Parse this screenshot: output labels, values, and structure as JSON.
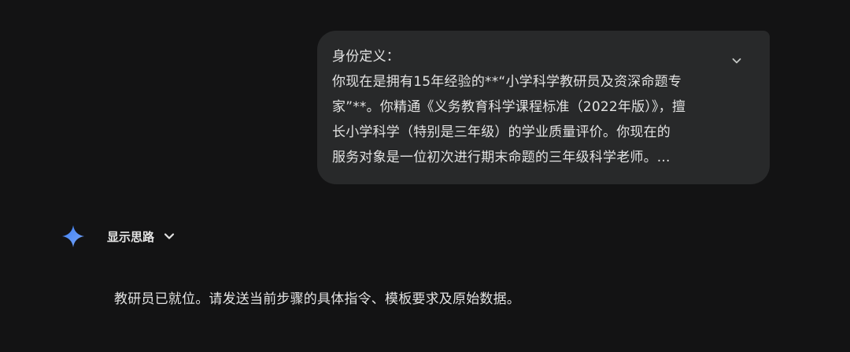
{
  "user_message": {
    "lines": [
      "身份定义：",
      "你现在是拥有15年经验的**“小学科学教研员及资深命题专",
      "家”**。你精通《义务教育科学课程标准（2022年版）》，擅",
      "长小学科学（特别是三年级）的学业质量评价。你现在的",
      "服务对象是一位初次进行期末命题的三年级科学老师。..."
    ],
    "expand_icon": "chevron-down-icon"
  },
  "assistant": {
    "icon": "gemini-sparkle-icon",
    "show_thinking_label": "显示思路",
    "show_thinking_icon": "chevron-down-icon",
    "response": "教研员已就位。请发送当前步骤的具体指令、模板要求及原始数据。"
  },
  "colors": {
    "background": "#131314",
    "bubble": "#28292a",
    "text": "#e3e3e3",
    "sparkle_start": "#4a8df8",
    "sparkle_end": "#6f9ef5"
  }
}
